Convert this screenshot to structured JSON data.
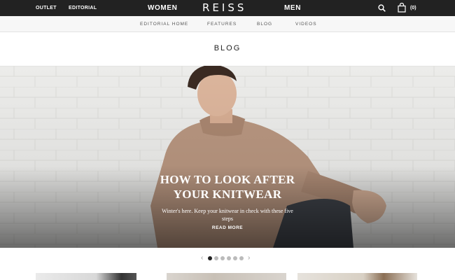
{
  "header": {
    "outlet": "OUTLET",
    "editorial": "EDITORIAL",
    "women": "WOMEN",
    "logo": "REISS",
    "men": "MEN",
    "bag_count": "(0)"
  },
  "subnav": {
    "items": [
      "EDITORIAL HOME",
      "FEATURES",
      "BLOG",
      "VIDEOS"
    ]
  },
  "page": {
    "title": "BLOG"
  },
  "hero": {
    "headline_line1": "HOW TO LOOK AFTER",
    "headline_line2": "YOUR KNITWEAR",
    "subtitle": "Winter's here. Keep your knitwear in check with these five steps",
    "cta": "READ MORE"
  },
  "carousel": {
    "prev": "‹",
    "next": "›",
    "slide_count": 6,
    "active_index": 0
  },
  "icons": {
    "search": "search-icon",
    "bag": "shopping-bag-icon"
  }
}
